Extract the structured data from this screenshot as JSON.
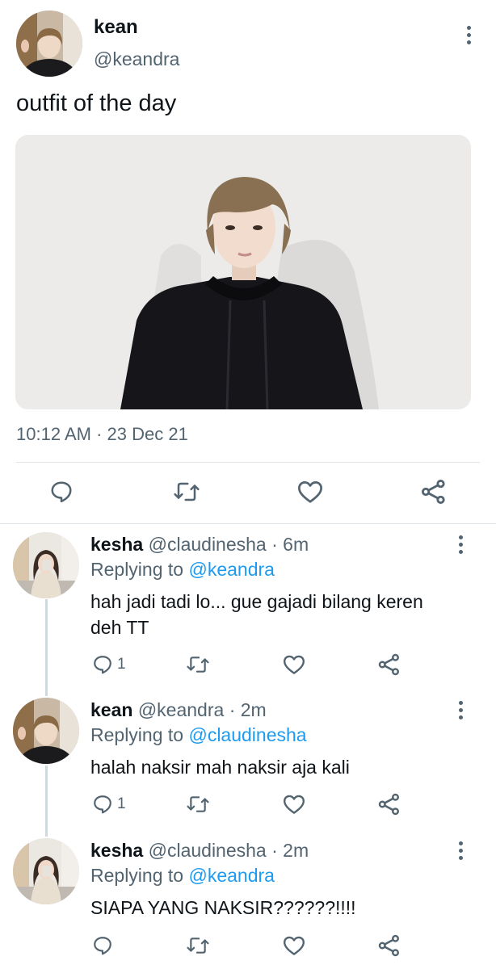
{
  "main_tweet": {
    "display_name": "kean",
    "handle": "@keandra",
    "text": "outfit of the day",
    "time": "10:12 AM",
    "separator": "·",
    "date": "23 Dec 21",
    "actions": [
      "reply-icon",
      "retweet-icon",
      "like-icon",
      "share-icon"
    ]
  },
  "replies": [
    {
      "display_name": "kesha",
      "handle": "@claudinesha",
      "age": "· 6m",
      "replying_prefix": "Replying to",
      "replying_to": "@keandra",
      "text_line1": "hah jadi tadi lo... gue gajadi bilang keren",
      "text_line2": "deh TT",
      "reply_count": "1"
    },
    {
      "display_name": "kean",
      "handle": "@keandra",
      "age": "· 2m",
      "replying_prefix": "Replying to",
      "replying_to": "@claudinesha",
      "text_line1": "halah naksir mah naksir aja kali",
      "reply_count": "1"
    },
    {
      "display_name": "kesha",
      "handle": "@claudinesha",
      "age": "· 2m",
      "replying_prefix": "Replying to",
      "replying_to": "@keandra",
      "text_line1": "SIAPA YANG NAKSIR??????!!!!"
    }
  ],
  "colors": {
    "text": "#0f1419",
    "secondary": "#536471",
    "link": "#1d9bf0",
    "divider": "#dde3e7"
  }
}
